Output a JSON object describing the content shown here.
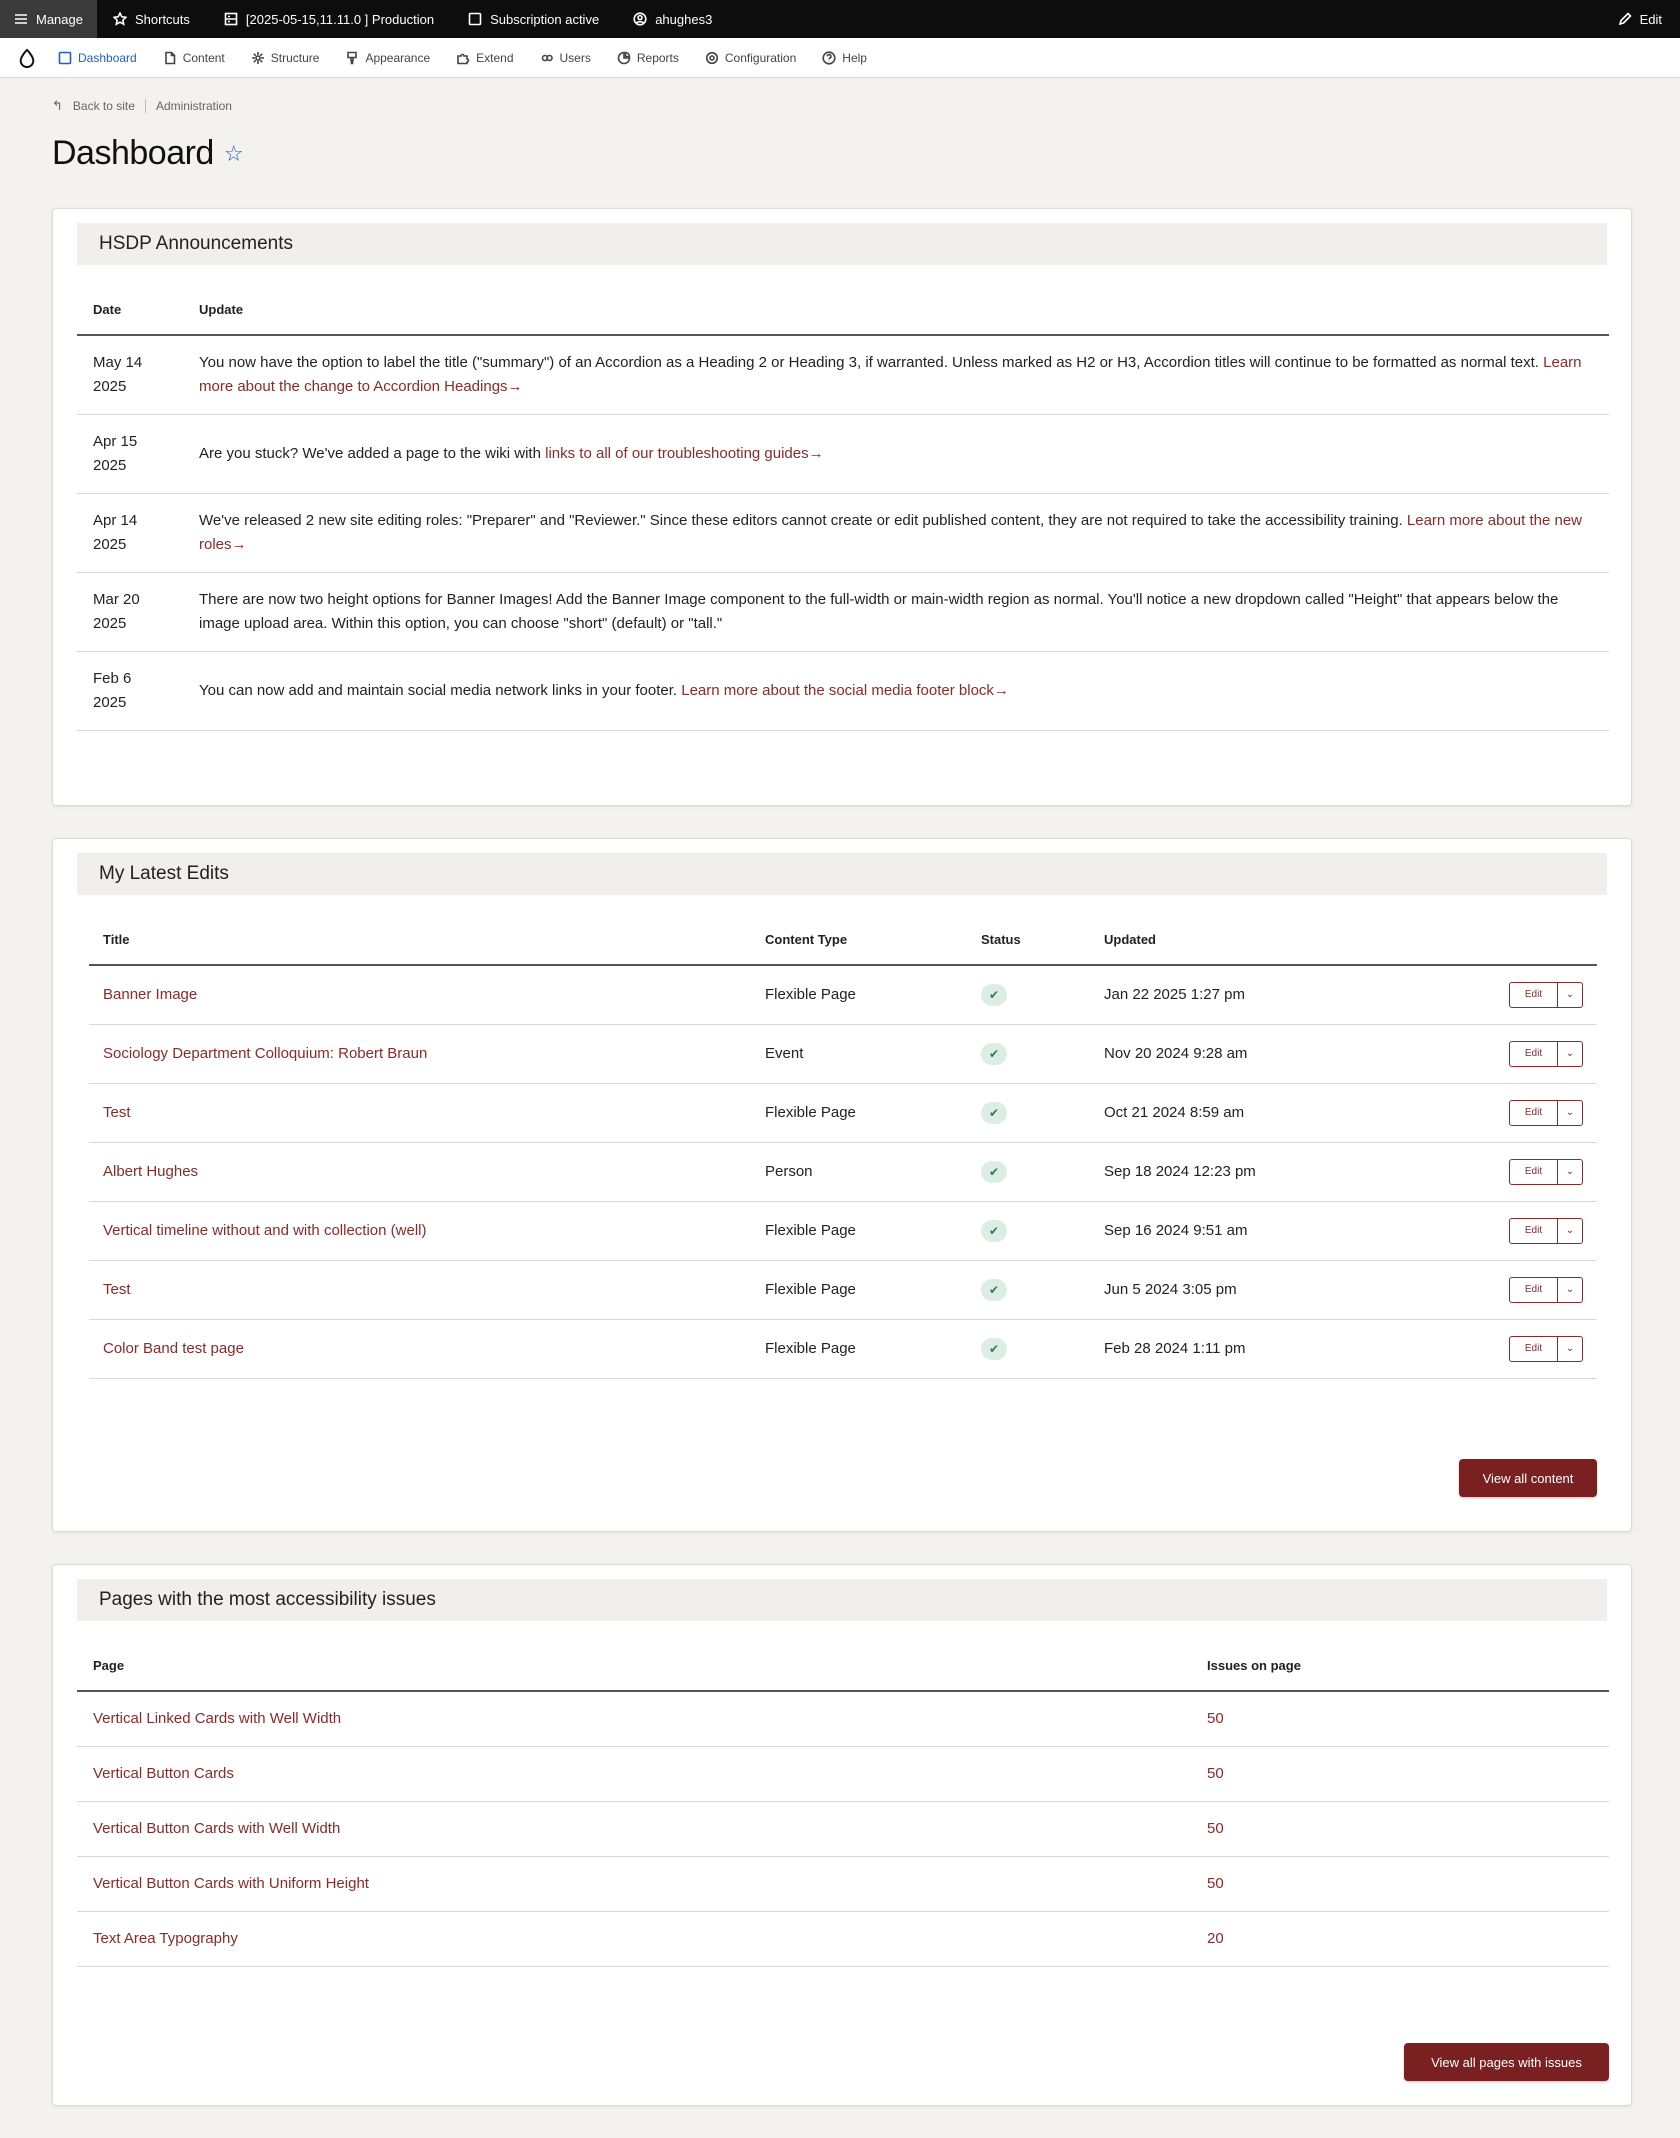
{
  "toolbar": {
    "manage": "Manage",
    "shortcuts": "Shortcuts",
    "environment": "[2025-05-15,11.11.0 ] Production",
    "subscription": "Subscription active",
    "user": "ahughes3",
    "edit": "Edit"
  },
  "tray": {
    "items": [
      "Dashboard",
      "Content",
      "Structure",
      "Appearance",
      "Extend",
      "Users",
      "Reports",
      "Configuration",
      "Help"
    ]
  },
  "breadcrumb": {
    "back": "Back to site",
    "current": "Administration"
  },
  "page": {
    "title": "Dashboard"
  },
  "announcements": {
    "heading": "HSDP Announcements",
    "col_date": "Date",
    "col_update": "Update",
    "rows": [
      {
        "date1": "May 14",
        "date2": "2025",
        "text": "You now have the option to label the title (\"summary\") of an Accordion as a Heading 2 or Heading 3, if warranted. Unless marked as H2 or H3, Accordion titles will continue to be formatted as normal text. ",
        "link": "Learn more about the change to Accordion Headings→"
      },
      {
        "date1": "Apr 15",
        "date2": "2025",
        "text": "Are you stuck? We've added a page to the wiki with ",
        "link": "links to all of our troubleshooting guides→"
      },
      {
        "date1": "Apr 14",
        "date2": "2025",
        "text": "We've released 2 new site editing roles: \"Preparer\" and \"Reviewer.\" Since these editors cannot create or edit published content, they are not required to take the accessibility training. ",
        "link": "Learn more about the new roles→"
      },
      {
        "date1": "Mar 20",
        "date2": "2025",
        "text": "There are now two height options for Banner Images! Add the Banner Image component to the full-width or main-width region as normal. You'll notice a new dropdown called \"Height\" that appears below the image upload area. Within this option, you can choose \"short\" (default) or \"tall.\"",
        "link": ""
      },
      {
        "date1": "Feb 6",
        "date2": "2025",
        "text": "You can now add and maintain social media network links in your footer. ",
        "link": "Learn more about the social media footer block→"
      }
    ]
  },
  "edits": {
    "heading": "My Latest Edits",
    "col_title": "Title",
    "col_type": "Content Type",
    "col_status": "Status",
    "col_updated": "Updated",
    "edit_label": "Edit",
    "check": "✔",
    "rows": [
      {
        "title": "Banner Image",
        "type": "Flexible Page",
        "updated": "Jan 22 2025 1:27 pm"
      },
      {
        "title": "Sociology Department Colloquium: Robert Braun",
        "type": "Event",
        "updated": "Nov 20 2024 9:28 am"
      },
      {
        "title": "Test",
        "type": "Flexible Page",
        "updated": "Oct 21 2024 8:59 am"
      },
      {
        "title": "Albert Hughes",
        "type": "Person",
        "updated": "Sep 18 2024 12:23 pm"
      },
      {
        "title": "Vertical timeline without and with collection (well)",
        "type": "Flexible Page",
        "updated": "Sep 16 2024 9:51 am"
      },
      {
        "title": "Test",
        "type": "Flexible Page",
        "updated": "Jun 5 2024 3:05 pm"
      },
      {
        "title": "Color Band test page",
        "type": "Flexible Page",
        "updated": "Feb 28 2024 1:11 pm"
      }
    ],
    "view_all": "View all content"
  },
  "a11y": {
    "heading": "Pages with the most accessibility issues",
    "col_page": "Page",
    "col_issues": "Issues on page",
    "rows": [
      {
        "page": "Vertical Linked Cards with Well Width",
        "issues": "50"
      },
      {
        "page": "Vertical Button Cards",
        "issues": "50"
      },
      {
        "page": "Vertical Button Cards with Well Width",
        "issues": "50"
      },
      {
        "page": "Vertical Button Cards with Uniform Height",
        "issues": "50"
      },
      {
        "page": "Text Area Typography",
        "issues": "20"
      }
    ],
    "view_all": "View all pages with issues"
  }
}
